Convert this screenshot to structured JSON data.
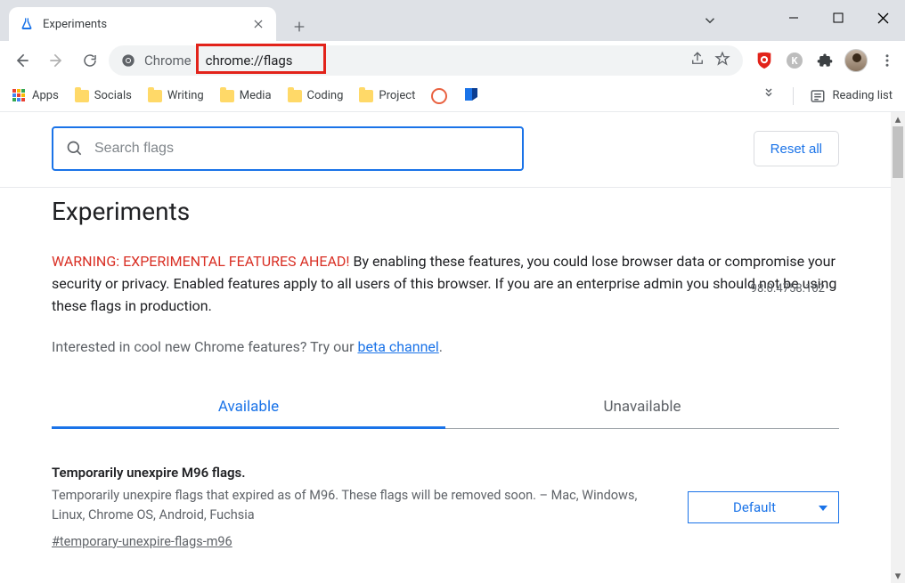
{
  "tab": {
    "title": "Experiments"
  },
  "omnibox": {
    "schemeLabel": "Chrome",
    "url": "chrome://flags"
  },
  "bookmarks": {
    "apps": "Apps",
    "items": [
      "Socials",
      "Writing",
      "Media",
      "Coding",
      "Project"
    ],
    "readingList": "Reading list"
  },
  "search": {
    "placeholder": "Search flags"
  },
  "resetLabel": "Reset all",
  "page": {
    "title": "Experiments",
    "version": "98.0.4758.102",
    "warningPrefix": "WARNING: EXPERIMENTAL FEATURES AHEAD!",
    "warningBody": " By enabling these features, you could lose browser data or compromise your security or privacy. Enabled features apply to all users of this browser. If you are an enterprise admin you should not be using these flags in production.",
    "betaPrompt": "Interested in cool new Chrome features? Try our ",
    "betaLink": "beta channel",
    "tabs": {
      "available": "Available",
      "unavailable": "Unavailable"
    }
  },
  "flag": {
    "title": "Temporarily unexpire M96 flags.",
    "desc": "Temporarily unexpire flags that expired as of M96. These flags will be removed soon. – Mac, Windows, Linux, Chrome OS, Android, Fuchsia",
    "hash": "#temporary-unexpire-flags-m96",
    "selected": "Default"
  }
}
